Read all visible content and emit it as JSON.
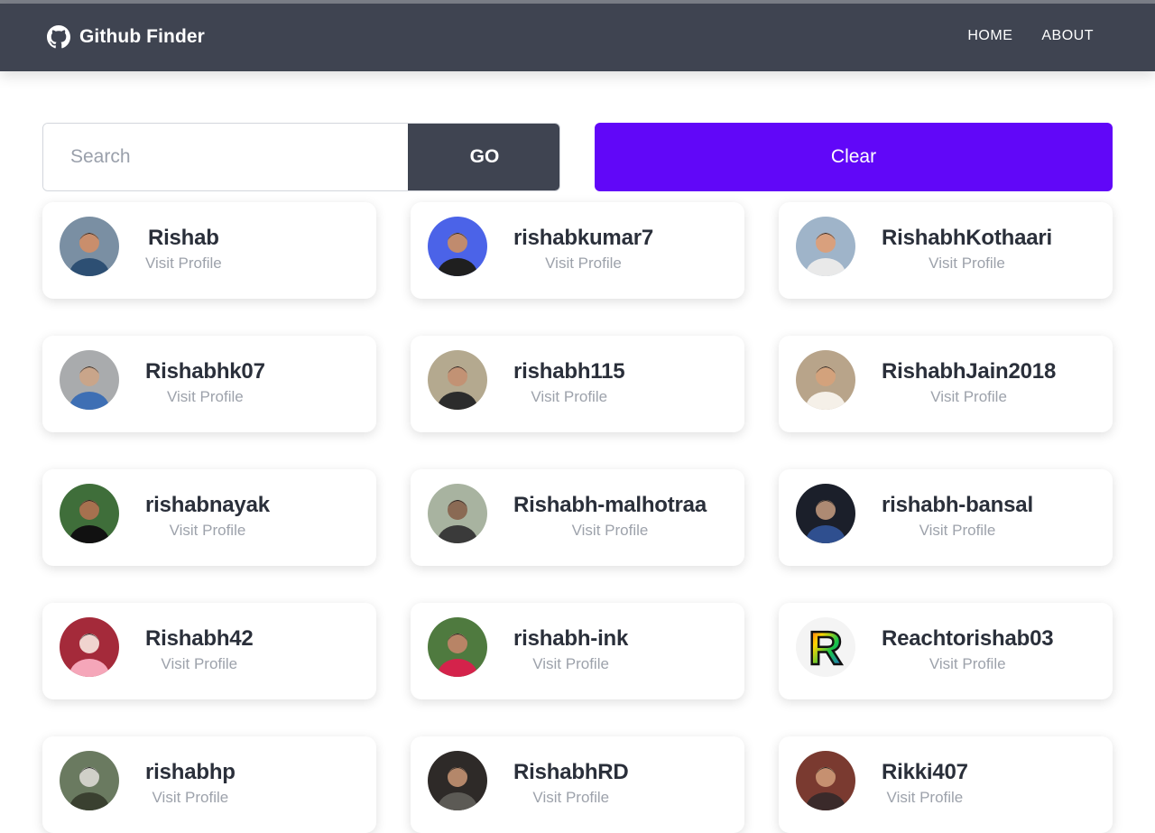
{
  "navbar": {
    "brand": "Github Finder",
    "links": [
      "HOME",
      "ABOUT"
    ]
  },
  "search": {
    "placeholder": "Search",
    "value": "",
    "go_label": "GO",
    "clear_label": "Clear"
  },
  "colors": {
    "navbar": "#3f4451",
    "go_button": "#3f4451",
    "clear_button": "#6107f8"
  },
  "users": [
    {
      "login": "Rishab",
      "link": "Visit Profile"
    },
    {
      "login": "rishabkumar7",
      "link": "Visit Profile"
    },
    {
      "login": "RishabhKothaari",
      "link": "Visit Profile"
    },
    {
      "login": "Rishabhk07",
      "link": "Visit Profile"
    },
    {
      "login": "rishabh115",
      "link": "Visit Profile"
    },
    {
      "login": "RishabhJain2018",
      "link": "Visit Profile"
    },
    {
      "login": "rishabnayak",
      "link": "Visit Profile"
    },
    {
      "login": "Rishabh-malhotraa",
      "link": "Visit Profile"
    },
    {
      "login": "rishabh-bansal",
      "link": "Visit Profile"
    },
    {
      "login": "Rishabh42",
      "link": "Visit Profile"
    },
    {
      "login": "rishabh-ink",
      "link": "Visit Profile"
    },
    {
      "login": "Reachtorishab03",
      "link": "Visit Profile"
    },
    {
      "login": "rishabhp",
      "link": "Visit Profile"
    },
    {
      "login": "RishabhRD",
      "link": "Visit Profile"
    },
    {
      "login": "Rikki407",
      "link": "Visit Profile"
    }
  ]
}
